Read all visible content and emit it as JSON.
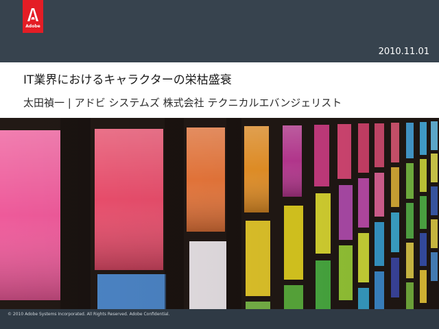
{
  "header": {
    "logo_text": "Adobe",
    "date": "2010.11.01"
  },
  "slide": {
    "title": "IT業界におけるキャラクターの栄枯盛衰",
    "subtitle": "太田禎一 | アドビ システムズ 株式会社 テクニカルエバンジェリスト"
  },
  "footer": {
    "copyright": "© 2010 Adobe Systems Incorporated.  All Rights Reserved.  Adobe Confidential."
  },
  "colors": {
    "header_bg": "#37434e",
    "logo_red": "#e41d25",
    "footer_bg": "#2f3a45"
  }
}
